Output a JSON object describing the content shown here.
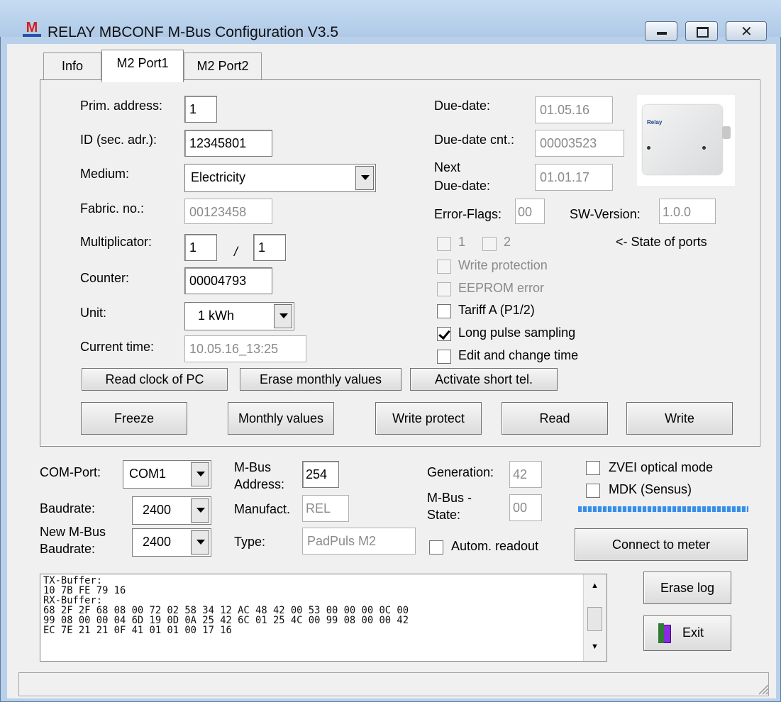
{
  "window": {
    "title": "RELAY MBCONF  M-Bus Configuration  V3.5",
    "app_icon": "M"
  },
  "tabs": [
    {
      "label": "Info",
      "active": false
    },
    {
      "label": "M2 Port1",
      "active": true
    },
    {
      "label": "M2 Port2",
      "active": false
    }
  ],
  "port": {
    "prim_address_label": "Prim. address:",
    "prim_address": "1",
    "id_label": "ID (sec. adr.):",
    "id": "12345801",
    "medium_label": "Medium:",
    "medium": "Electricity",
    "fabric_label": "Fabric. no.:",
    "fabric": "00123458",
    "multiplicator_label": "Multiplicator:",
    "mult_num": "1",
    "mult_sep": "/",
    "mult_den": "1",
    "counter_label": "Counter:",
    "counter": "00004793",
    "unit_label": "Unit:",
    "unit": "1 kWh",
    "time_label": "Current time:",
    "time": "10.05.16_13:25",
    "due_label": "Due-date:",
    "due": "01.05.16",
    "due_cnt_label": "Due-date cnt.:",
    "due_cnt": "00003523",
    "next_due_label_1": "Next",
    "next_due_label_2": "Due-date:",
    "next_due": "01.01.17",
    "error_flags_label": "Error-Flags:",
    "error_flags": "00",
    "sw_label": "SW-Version:",
    "sw": "1.0.0",
    "state_port_1": "1",
    "state_port_2": "2",
    "state_of_ports": "<- State of ports",
    "chk_write_protection": "Write protection",
    "chk_eeprom": "EEPROM error",
    "chk_tariff": "Tariff A (P1/2)",
    "chk_long_pulse": "Long pulse sampling",
    "chk_edit_time": "Edit and change time",
    "btn_read_clock": "Read clock of PC",
    "btn_erase_monthly": "Erase monthly values",
    "btn_short_tel": "Activate short tel.",
    "btn_freeze": "Freeze",
    "btn_monthly": "Monthly values",
    "btn_write_protect": "Write protect",
    "btn_read": "Read",
    "btn_write": "Write",
    "device_image_text": "Relay"
  },
  "connection": {
    "com_label": "COM-Port:",
    "com": "COM1",
    "baud_label": "Baudrate:",
    "baud": "2400",
    "new_baud_label_1": "New M-Bus",
    "new_baud_label_2": "Baudrate:",
    "new_baud": "2400",
    "mbus_addr_label_1": "M-Bus",
    "mbus_addr_label_2": "Address:",
    "mbus_addr": "254",
    "manufact_label": "Manufact.",
    "manufact": "REL",
    "type_label": "Type:",
    "type": "PadPuls M2",
    "generation_label": "Generation:",
    "generation": "42",
    "mbus_state_label_1": "M-Bus -",
    "mbus_state_label_2": "State:",
    "mbus_state": "00",
    "zvei_label": "ZVEI optical mode",
    "mdk_label": "MDK (Sensus)",
    "autom_label": "Autom. readout",
    "btn_connect": "Connect to meter",
    "btn_erase_log": "Erase log",
    "btn_exit": "Exit"
  },
  "log": {
    "text": "TX-Buffer:\n10 7B FE 79 16\nRX-Buffer:\n68 2F 2F 68 08 00 72 02 58 34 12 AC 48 42 00 53 00 00 00 0C 00\n99 08 00 00 04 6D 19 0D 0A 25 42 6C 01 25 4C 00 99 08 00 00 42\nEC 7E 21 21 0F 41 01 01 00 17 16"
  },
  "states": {
    "state_port_1": false,
    "state_port_2": false,
    "write_protection": false,
    "eeprom_error": false,
    "tariff": false,
    "long_pulse": true,
    "edit_time": false,
    "zvei": false,
    "mdk": false,
    "autom": false
  },
  "colors": {
    "title_bar": "#b8d0ea",
    "progress": "#3a8ee6"
  }
}
